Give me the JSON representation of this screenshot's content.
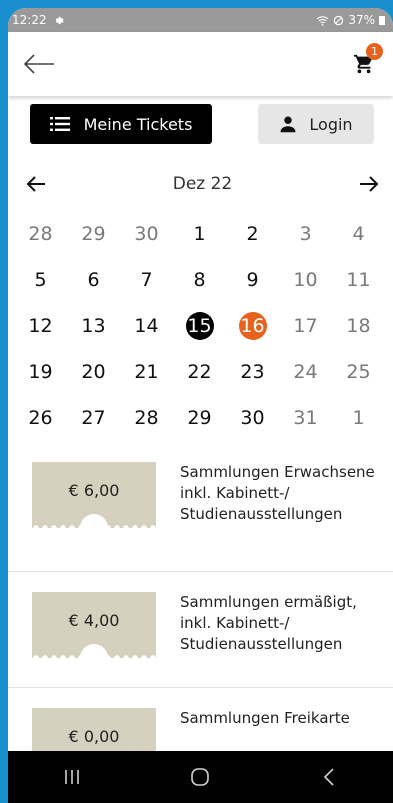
{
  "status_bar": {
    "time": "12:22",
    "battery": "37%"
  },
  "header": {
    "cart_count": "1"
  },
  "actions": {
    "tickets_label": "Meine Tickets",
    "login_label": "Login"
  },
  "calendar": {
    "month_label": "Dez 22",
    "days": [
      {
        "n": "28",
        "state": "muted"
      },
      {
        "n": "29",
        "state": "muted"
      },
      {
        "n": "30",
        "state": "muted"
      },
      {
        "n": "1",
        "state": "normal"
      },
      {
        "n": "2",
        "state": "normal"
      },
      {
        "n": "3",
        "state": "muted"
      },
      {
        "n": "4",
        "state": "muted"
      },
      {
        "n": "5",
        "state": "normal"
      },
      {
        "n": "6",
        "state": "normal"
      },
      {
        "n": "7",
        "state": "normal"
      },
      {
        "n": "8",
        "state": "normal"
      },
      {
        "n": "9",
        "state": "normal"
      },
      {
        "n": "10",
        "state": "muted"
      },
      {
        "n": "11",
        "state": "muted"
      },
      {
        "n": "12",
        "state": "normal"
      },
      {
        "n": "13",
        "state": "normal"
      },
      {
        "n": "14",
        "state": "normal"
      },
      {
        "n": "15",
        "state": "selected"
      },
      {
        "n": "16",
        "state": "highlight"
      },
      {
        "n": "17",
        "state": "muted"
      },
      {
        "n": "18",
        "state": "muted"
      },
      {
        "n": "19",
        "state": "normal"
      },
      {
        "n": "20",
        "state": "normal"
      },
      {
        "n": "21",
        "state": "normal"
      },
      {
        "n": "22",
        "state": "normal"
      },
      {
        "n": "23",
        "state": "normal"
      },
      {
        "n": "24",
        "state": "muted"
      },
      {
        "n": "25",
        "state": "muted"
      },
      {
        "n": "26",
        "state": "normal"
      },
      {
        "n": "27",
        "state": "normal"
      },
      {
        "n": "28",
        "state": "normal"
      },
      {
        "n": "29",
        "state": "normal"
      },
      {
        "n": "30",
        "state": "normal"
      },
      {
        "n": "31",
        "state": "muted"
      },
      {
        "n": "1",
        "state": "muted"
      }
    ]
  },
  "tickets": [
    {
      "price": "€ 6,00",
      "lines": [
        "Sammlungen Erwachsene",
        "inkl. Kabinett-/",
        "Studienausstellungen"
      ]
    },
    {
      "price": "€ 4,00",
      "lines": [
        "Sammlungen ermäßigt,",
        "inkl. Kabinett-/",
        "Studienausstellungen"
      ]
    },
    {
      "price": "€ 0,00",
      "lines": [
        "Sammlungen Freikarte"
      ]
    }
  ],
  "colors": {
    "accent": "#e8621e",
    "stub": "#d6d1bf",
    "frame": "#1a8fd0"
  }
}
